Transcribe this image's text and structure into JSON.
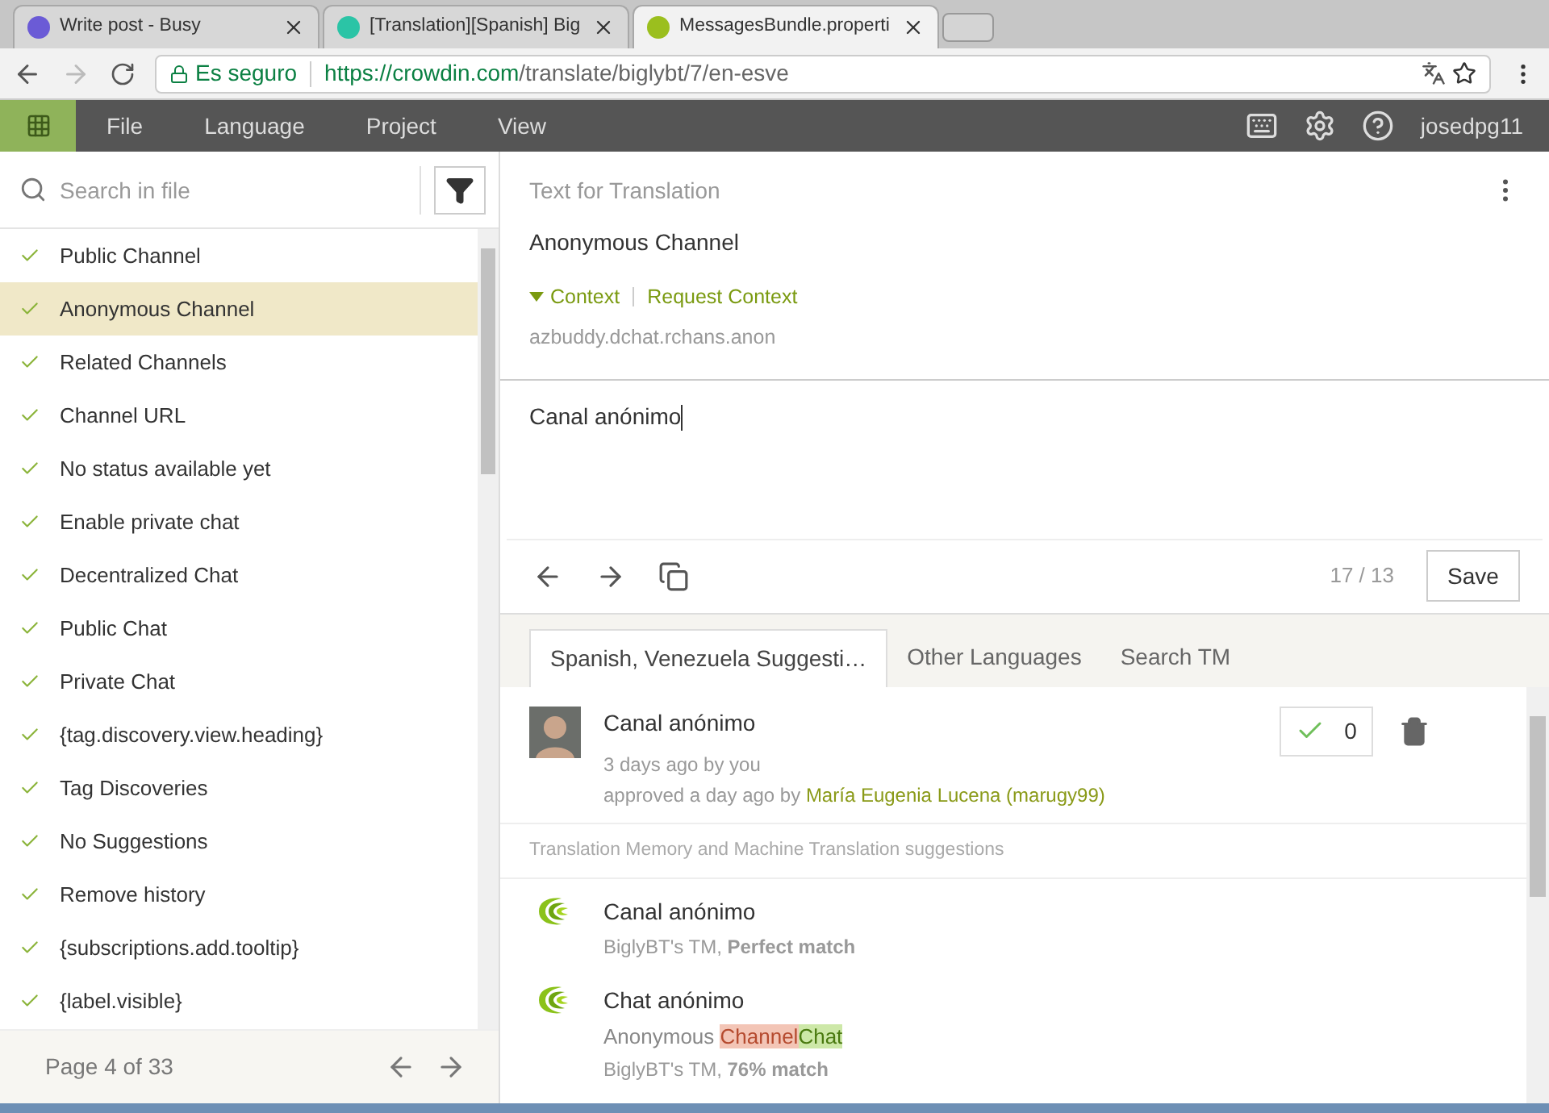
{
  "browser": {
    "tabs": [
      {
        "title": "Write post - Busy",
        "selected": false
      },
      {
        "title": "[Translation][Spanish] Big",
        "selected": false
      },
      {
        "title": "MessagesBundle.properti",
        "selected": true
      }
    ],
    "secure_label": "Es seguro",
    "url_host": "https://crowdin.com",
    "url_path": "/translate/biglybt/7/en-esve"
  },
  "menu": {
    "items": [
      "File",
      "Language",
      "Project",
      "View"
    ],
    "user": "josedpg11"
  },
  "sidebar": {
    "search": {
      "placeholder": "Search in file"
    },
    "items": [
      {
        "label": "Public Channel",
        "selected": false
      },
      {
        "label": "Anonymous Channel",
        "selected": true
      },
      {
        "label": "Related Channels",
        "selected": false
      },
      {
        "label": "Channel URL",
        "selected": false
      },
      {
        "label": "No status available yet",
        "selected": false
      },
      {
        "label": "Enable private chat",
        "selected": false
      },
      {
        "label": "Decentralized Chat",
        "selected": false
      },
      {
        "label": "Public Chat",
        "selected": false
      },
      {
        "label": "Private Chat",
        "selected": false
      },
      {
        "label": "{tag.discovery.view.heading}",
        "selected": false
      },
      {
        "label": "Tag Discoveries",
        "selected": false
      },
      {
        "label": "No Suggestions",
        "selected": false
      },
      {
        "label": "Remove history",
        "selected": false
      },
      {
        "label": "{subscriptions.add.tooltip}",
        "selected": false
      },
      {
        "label": "{label.visible}",
        "selected": false
      }
    ],
    "pager": "Page 4 of 33"
  },
  "source": {
    "heading": "Text for Translation",
    "text": "Anonymous Channel",
    "context_link": "Context",
    "request_link": "Request Context",
    "key": "azbuddy.dchat.rchans.anon"
  },
  "editor": {
    "value": "Canal anónimo",
    "counter": "17 / 13",
    "save": "Save"
  },
  "suggestion_tabs": [
    {
      "label": "Spanish, Venezuela Suggesti…",
      "selected": true
    },
    {
      "label": "Other Languages",
      "selected": false
    },
    {
      "label": "Search TM",
      "selected": false
    }
  ],
  "suggestion": {
    "text": "Canal anónimo",
    "meta": "3 days ago by you",
    "approved_prefix": "approved a day ago by",
    "approver": "María Eugenia Lucena (marugy99)",
    "votes": "0"
  },
  "tm_heading": "Translation Memory and Machine Translation suggestions",
  "tm": [
    {
      "text": "Canal anónimo",
      "meta": "BiglyBT's TM, **Perfect match**"
    },
    {
      "text": "Chat anónimo",
      "source": [
        {
          "kind": "same",
          "text": "Anonymous "
        },
        {
          "kind": "removed",
          "text": "Channel"
        },
        {
          "kind": "added",
          "text": "Chat"
        }
      ],
      "meta": "BiglyBT's TM, **76% match**"
    }
  ]
}
